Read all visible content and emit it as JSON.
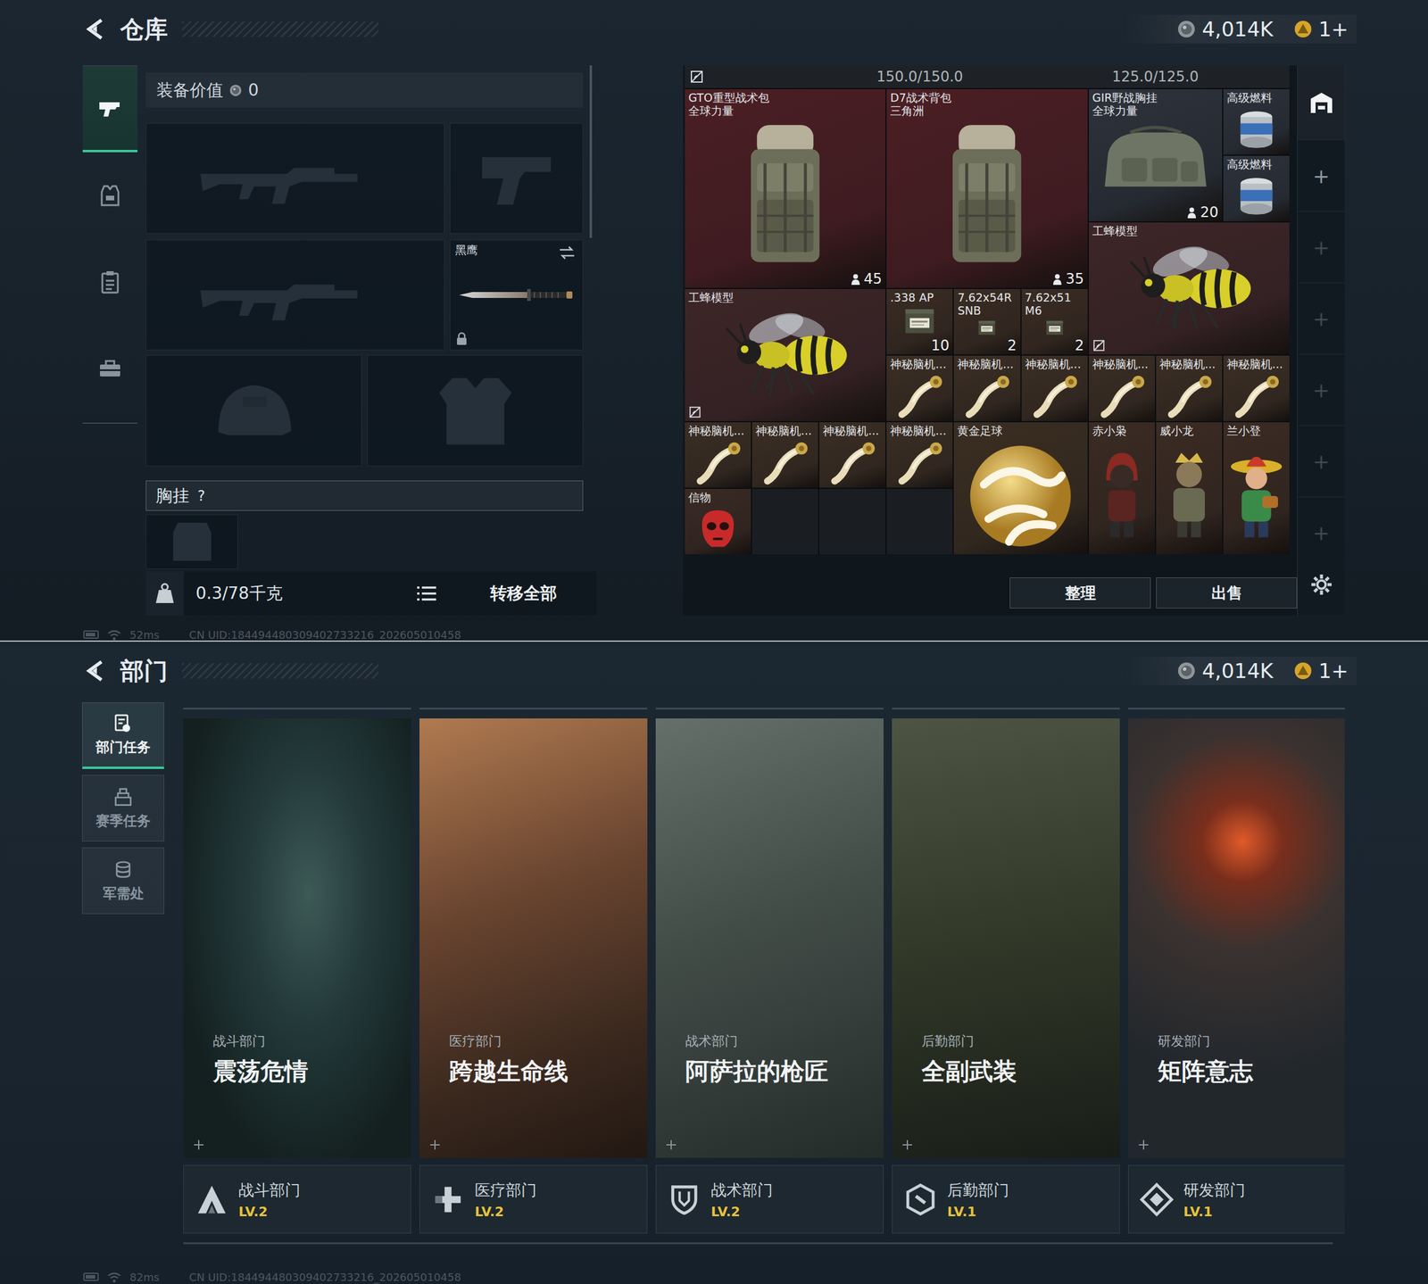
{
  "warehouse": {
    "title": "仓库",
    "currency": {
      "coins": "4,014K",
      "tokens": "1+"
    },
    "nav_tabs": [
      {
        "selected": true
      },
      {
        "selected": false
      },
      {
        "selected": false
      },
      {
        "selected": false
      }
    ],
    "equipment": {
      "value_label": "装备价值",
      "value": "0",
      "slots": [
        {
          "kind": "rifle"
        },
        {
          "kind": "pistol"
        },
        {
          "kind": "rifle"
        },
        {
          "kind": "melee",
          "label": "黑鹰",
          "locked": true
        },
        {
          "kind": "helmet"
        },
        {
          "kind": "armor"
        }
      ],
      "chest_rig": {
        "label": "胸挂",
        "help": "?"
      },
      "weight": "0.3/78千克",
      "transfer_all": "转移全部"
    },
    "storage": {
      "bound_mark": true,
      "capacities": [
        "150.0/150.0",
        "125.0/125.0"
      ],
      "items": [
        {
          "name": "GTO重型战术包",
          "brand": "全球力量",
          "count": "45",
          "count_icon": true,
          "kind": "backpack",
          "color": "#4b1f24"
        },
        {
          "name": "D7战术背包",
          "brand": "三角洲",
          "count": "35",
          "count_icon": true,
          "kind": "backpack",
          "color": "#4b1f24"
        },
        {
          "name": "GIR野战胸挂",
          "brand": "全球力量",
          "count": "20",
          "count_icon": true,
          "kind": "vest",
          "color": "#2d323b"
        },
        {
          "name": "高级燃料",
          "kind": "fuel",
          "color": "#2d323b"
        },
        {
          "name": "高级燃料",
          "kind": "fuel",
          "color": "#2d323b"
        },
        {
          "name": "工蜂模型",
          "bound": true,
          "kind": "bee",
          "color": "#3e2628"
        },
        {
          "name": "工蜂模型",
          "bound": true,
          "kind": "bee",
          "color": "#3e2628"
        },
        {
          "name": ".338 AP",
          "count": "10",
          "kind": "ammo",
          "color": "#3a2c23"
        },
        {
          "name": "7.62x54R SNB",
          "count": "2",
          "kind": "ammo",
          "color": "#3a2c23"
        },
        {
          "name": "7.62x51 M6",
          "count": "2",
          "kind": "ammo",
          "color": "#3a2c23"
        },
        {
          "name": "神秘脑机...",
          "kind": "brain",
          "color": "#3b2e24"
        },
        {
          "name": "神秘脑机...",
          "kind": "brain",
          "color": "#3b2e24"
        },
        {
          "name": "神秘脑机...",
          "kind": "brain",
          "color": "#3b2e24"
        },
        {
          "name": "神秘脑机...",
          "kind": "brain",
          "color": "#3b2e24"
        },
        {
          "name": "神秘脑机...",
          "kind": "brain",
          "color": "#3b2e24"
        },
        {
          "name": "神秘脑机...",
          "kind": "brain",
          "color": "#3b2e24"
        },
        {
          "name": "神秘脑机...",
          "kind": "brain",
          "color": "#3b2e24"
        },
        {
          "name": "神秘脑机...",
          "kind": "brain",
          "color": "#3b2e24"
        },
        {
          "name": "神秘脑机...",
          "kind": "brain",
          "color": "#3b2e24"
        },
        {
          "name": "神秘脑机...",
          "kind": "brain",
          "color": "#3b2e24"
        },
        {
          "name": "黄金足球",
          "kind": "ball",
          "color": "#3b2e22"
        },
        {
          "name": "赤小枭",
          "kind": "figure",
          "color": "#3b2b23"
        },
        {
          "name": "威小龙",
          "kind": "figure",
          "color": "#3b2b23"
        },
        {
          "name": "兰小登",
          "kind": "figure",
          "color": "#3b2b23"
        },
        {
          "name": "信物",
          "kind": "mask",
          "color": "#3a2a24"
        }
      ],
      "buttons": [
        "整理",
        "出售"
      ],
      "side_tabs": [
        {
          "kind": "storage",
          "selected": true
        },
        {
          "kind": "add",
          "label": "+",
          "disabled": false
        },
        {
          "kind": "add",
          "label": "+",
          "disabled": true
        },
        {
          "kind": "add",
          "label": "+",
          "disabled": true
        },
        {
          "kind": "add",
          "label": "+",
          "disabled": true
        },
        {
          "kind": "add",
          "label": "+",
          "disabled": true
        },
        {
          "kind": "add",
          "label": "+",
          "disabled": true
        }
      ]
    },
    "status": {
      "ping": "52ms",
      "uid": "CN UID:184494480309402733216_202605010458"
    }
  },
  "departments": {
    "title": "部门",
    "currency": {
      "coins": "4,014K",
      "tokens": "1+"
    },
    "tabs": [
      {
        "label": "部门任务",
        "selected": true
      },
      {
        "label": "赛季任务",
        "selected": false
      },
      {
        "label": "军需处",
        "selected": false
      }
    ],
    "cards": [
      {
        "department": "战斗部门",
        "mission": "震荡危情",
        "level": "LV.2"
      },
      {
        "department": "医疗部门",
        "mission": "跨越生命线",
        "level": "LV.2"
      },
      {
        "department": "战术部门",
        "mission": "阿萨拉的枪匠",
        "level": "LV.2"
      },
      {
        "department": "后勤部门",
        "mission": "全副武装",
        "level": "LV.1"
      },
      {
        "department": "研发部门",
        "mission": "矩阵意志",
        "level": "LV.1"
      }
    ],
    "status": {
      "ping": "82ms",
      "uid": "CN UID:184494480309402733216_202605010458"
    }
  }
}
